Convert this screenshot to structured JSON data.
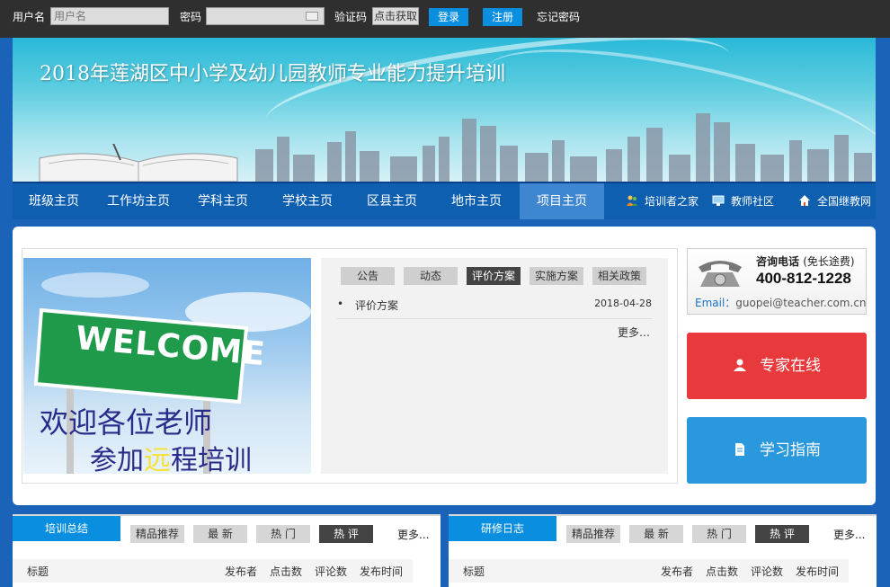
{
  "login": {
    "username_label": "用户名",
    "username_placeholder": "用户名",
    "password_label": "密码",
    "captcha_label": "验证码",
    "captcha_button": "点击获取",
    "login_button": "登录",
    "register_button": "注册",
    "forgot_link": "忘记密码"
  },
  "banner": {
    "title": "2018年莲湖区中小学及幼儿园教师专业能力提升培训"
  },
  "nav": {
    "items": [
      "班级主页",
      "工作坊主页",
      "学科主页",
      "学校主页",
      "区县主页",
      "地市主页",
      "项目主页"
    ],
    "active_index": 6,
    "links": [
      {
        "label": "培训者之家",
        "icon": "people-icon"
      },
      {
        "label": "教师社区",
        "icon": "monitor-icon"
      },
      {
        "label": "全国继教网",
        "icon": "home-icon"
      }
    ]
  },
  "welcome": {
    "sign_text": "WELCOME",
    "line1": "欢迎各位老师",
    "line2_a": "参加",
    "line2_b": "远",
    "line2_c": "程培训"
  },
  "news": {
    "tabs": [
      "公告",
      "动态",
      "评价方案",
      "实施方案",
      "相关政策"
    ],
    "active_tab": 2,
    "items": [
      {
        "bullet": "•",
        "title": "评价方案",
        "date": "2018-04-28"
      }
    ],
    "more": "更多…"
  },
  "contact": {
    "consult_label": "咨询电话",
    "consult_note": "(免长途费)",
    "phone": "400-812-1228",
    "email_label": "Email：",
    "email": "guopei@teacher.com.cn"
  },
  "actions": {
    "expert_label": "专家在线",
    "guide_label": "学习指南"
  },
  "panels": [
    {
      "title": "培训总结",
      "tabs": [
        "精品推荐",
        "最  新",
        "热  门",
        "热  评"
      ],
      "active_tab": 3,
      "more": "更多...",
      "columns": [
        "标题",
        "发布者",
        "点击数",
        "评论数",
        "发布时间"
      ]
    },
    {
      "title": "研修日志",
      "tabs": [
        "精品推荐",
        "最  新",
        "热  门",
        "热  评"
      ],
      "active_tab": 3,
      "more": "更多...",
      "columns": [
        "标题",
        "发布者",
        "点击数",
        "评论数",
        "发布时间"
      ]
    }
  ],
  "colors": {
    "accent_blue": "#0a8ee0",
    "nav_blue": "#0e5fb0",
    "expert_red": "#e83a3c",
    "guide_blue": "#2a98dc",
    "topbar": "#2f2f2f"
  }
}
